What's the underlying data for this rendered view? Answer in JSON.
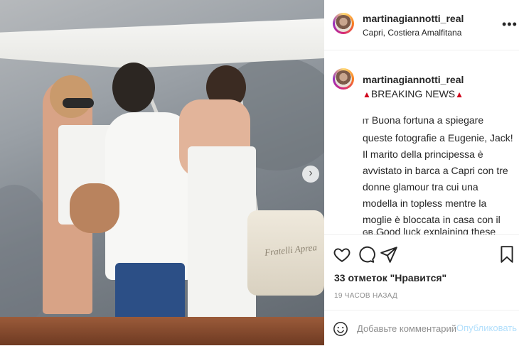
{
  "post": {
    "username": "martinagiannotti_real",
    "location": "Capri, Costiera Amalfitana",
    "more_icon": "more-horizontal-icon"
  },
  "photo": {
    "seat_text": "Fratelli Aprea",
    "next_icon": "chevron-right-icon"
  },
  "caption": {
    "username": "martinagiannotti_real",
    "headline": "BREAKING NEWS",
    "emoji_icon": "rotating-light-icon",
    "it_flag": "IT",
    "it_text": "Buona fortuna a spiegare queste fotografie a Eugenie, Jack! Il marito della principessa è avvistato in barca a Capri con tre donne glamour tra cui una modella in topless mentre la moglie è bloccata in casa con il bambino.",
    "gb_flag": "GB",
    "gb_text": "Good luck explaining these"
  },
  "actions": {
    "like_icon": "heart-icon",
    "comment_icon": "comment-icon",
    "share_icon": "paper-plane-icon",
    "save_icon": "bookmark-icon",
    "likes_text": "33 отметок \"Нравится\"",
    "timestamp": "19 ЧАСОВ НАЗАД"
  },
  "comment": {
    "placeholder": "Добавьте комментарий...",
    "post_label": "Опубликовать",
    "emoji_icon": "smiley-icon"
  },
  "colors": {
    "link": "#b2dffc",
    "text": "#262626",
    "muted": "#8e8e8e"
  }
}
